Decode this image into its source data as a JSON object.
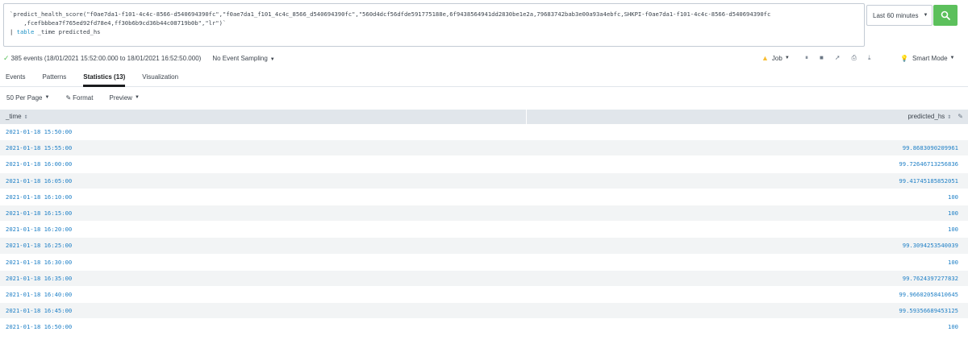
{
  "search": {
    "query_line1": "`predict_health_score(\"f0ae7da1-f101-4c4c-8566-d540694390fc\",\"f0ae7da1_f101_4c4c_8566_d540694390fc\",\"560d4dcf56dfde591775188e,6f9438564941dd2830be1e2a,79683742bab3e00a93a4ebfc,SHKPI-f0ae7da1-f101-4c4c-8566-d540694390fc",
    "query_line2": "    ,fcefbbbea7f765ed92fd78e4,ff30b6b9cd36b44c08719b0b\",\"lr\")`",
    "query_line3_pipe": "| ",
    "query_line3_cmd": "table",
    "query_line3_rest": " _time predicted_hs",
    "time_range": "Last 60 minutes",
    "search_button_icon": "search-icon"
  },
  "status": {
    "summary": "385 events (18/01/2021 15:52:00.000 to 18/01/2021 16:52:50.000)",
    "sampling": "No Event Sampling",
    "job_label": "Job",
    "mode": "Smart Mode"
  },
  "tabs": [
    {
      "label": "Events"
    },
    {
      "label": "Patterns"
    },
    {
      "label": "Statistics (13)"
    },
    {
      "label": "Visualization"
    }
  ],
  "toolbar": {
    "per_page": "50 Per Page",
    "format": "Format",
    "preview": "Preview"
  },
  "table": {
    "columns": [
      "_time",
      "predicted_hs"
    ],
    "rows": [
      {
        "time": "2021-01-18 15:50:00",
        "value": ""
      },
      {
        "time": "2021-01-18 15:55:00",
        "value": "99.8683090209961"
      },
      {
        "time": "2021-01-18 16:00:00",
        "value": "99.72646713256836"
      },
      {
        "time": "2021-01-18 16:05:00",
        "value": "99.41745185852051"
      },
      {
        "time": "2021-01-18 16:10:00",
        "value": "100"
      },
      {
        "time": "2021-01-18 16:15:00",
        "value": "100"
      },
      {
        "time": "2021-01-18 16:20:00",
        "value": "100"
      },
      {
        "time": "2021-01-18 16:25:00",
        "value": "99.3094253540039"
      },
      {
        "time": "2021-01-18 16:30:00",
        "value": "100"
      },
      {
        "time": "2021-01-18 16:35:00",
        "value": "99.7624397277832"
      },
      {
        "time": "2021-01-18 16:40:00",
        "value": "99.96602058410645"
      },
      {
        "time": "2021-01-18 16:45:00",
        "value": "99.59356689453125"
      },
      {
        "time": "2021-01-18 16:50:00",
        "value": "100"
      }
    ]
  },
  "colors": {
    "accent_green": "#5cc05c",
    "link_blue": "#1e7fc6",
    "warning_yellow": "#f8be34"
  }
}
